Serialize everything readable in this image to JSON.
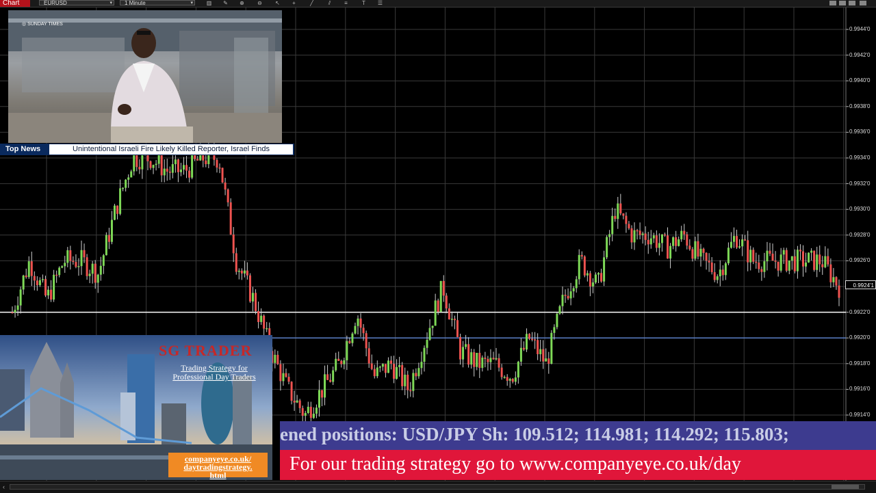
{
  "toolbar": {
    "chart_label": "Chart",
    "symbol": "EURUSD",
    "timeframe": "1 Minute",
    "icons": [
      "bars-icon",
      "pencil-icon",
      "zoom-in-icon",
      "zoom-out-icon",
      "cursor-icon",
      "crosshair-icon",
      "trendline-icon",
      "channel-icon",
      "fibonacci-icon",
      "text-icon",
      "grid-icon",
      "list-icon"
    ]
  },
  "price_axis": {
    "ticks": [
      "0.9944'0",
      "0.9942'0",
      "0.9940'0",
      "0.9938'0",
      "0.9936'0",
      "0.9934'0",
      "0.9932'0",
      "0.9930'0",
      "0.9928'0",
      "0.9926'0",
      "0.9924'0",
      "0.9922'0",
      "0.9920'0",
      "0.9918'0",
      "0.9916'0",
      "0.9914'0"
    ],
    "current_price": "0.9924'1"
  },
  "chart_data": {
    "type": "line",
    "instrument": "EURUSD",
    "interval": "1 Minute",
    "y_axis_range": [
      0.9912,
      0.9946
    ],
    "grid": true,
    "horizontal_levels": [
      {
        "price": 0.9922,
        "color": "#ffffff"
      },
      {
        "price": 0.992,
        "color": "#5b7fc7"
      }
    ],
    "series": [
      {
        "values": [
          0.9922,
          0.9926,
          0.9923,
          0.9926,
          0.9926,
          0.9925,
          0.993,
          0.9934,
          0.9934,
          0.9933,
          0.9933,
          0.9934,
          0.9934,
          0.9926,
          0.9923,
          0.9919,
          0.9916,
          0.9914,
          0.9916,
          0.9918,
          0.9922,
          0.9917,
          0.9918,
          0.9916,
          0.992,
          0.9924,
          0.9919,
          0.9918,
          0.9918,
          0.9917,
          0.992,
          0.9918,
          0.9923,
          0.9926,
          0.9924,
          0.993,
          0.9928,
          0.9928,
          0.9927,
          0.9928,
          0.9926,
          0.9925,
          0.9928,
          0.9926,
          0.9926,
          0.9926,
          0.9926,
          0.9926,
          0.9924
        ]
      }
    ],
    "current_price": 0.99241,
    "up_color": "#7ed957",
    "down_color": "#ef5350"
  },
  "video": {
    "channel": "SUNDAY TIMES",
    "news_tag": "Top News",
    "headline": "Unintentional Israeli Fire Likely Killed Reporter, Israel Finds"
  },
  "ad": {
    "title": "SG TRADER",
    "subtitle": "Trading Strategy for Professional Day Traders",
    "link_lines": [
      "companyeye.co.uk/",
      "daytradingstrategy.",
      "html"
    ]
  },
  "tickers": {
    "positions": "ened positions: USD/JPY Sh:  109.512; 114.981; 114.292; 115.803;",
    "promo": "For our trading strategy go to  www.companyeye.co.uk/day"
  },
  "colors": {
    "chart_bg": "#000000",
    "grid": "#3a3a3a",
    "news_blue": "#0a2a5e",
    "ticker_purple": "#3d3b8f",
    "ticker_red": "#e0163a",
    "ad_orange": "#f08a24"
  }
}
